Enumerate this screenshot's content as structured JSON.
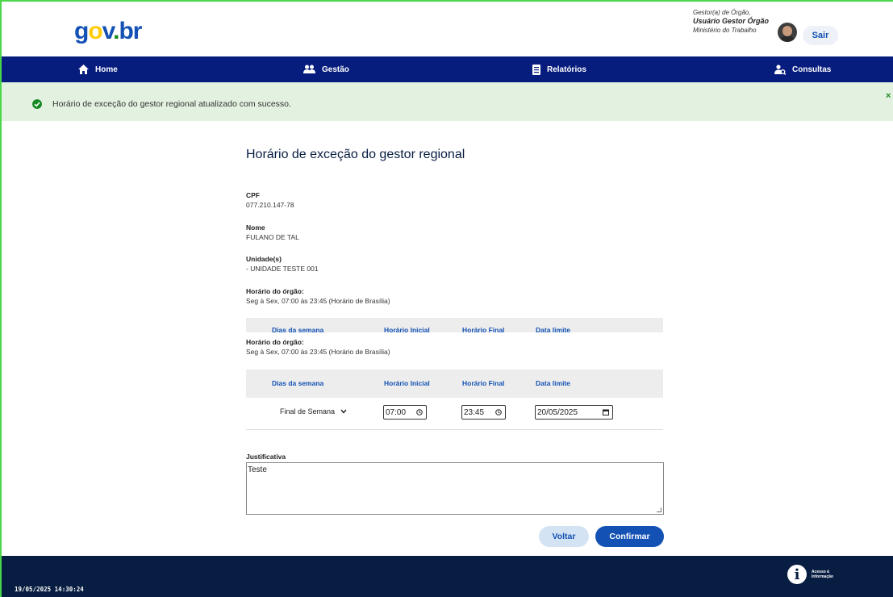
{
  "header": {
    "logo": {
      "g": "g",
      "o": "o",
      "v": "v",
      "dot": ".",
      "br": "br"
    },
    "user_role": "Gestor(a) de Órgão,",
    "user_name": "Usuário Gestor Órgão",
    "user_org": "Ministério do Trabalho",
    "logout_label": "Sair"
  },
  "nav": {
    "items": [
      {
        "label": "Home",
        "icon": "home-icon"
      },
      {
        "label": "Gestão",
        "icon": "users-icon"
      },
      {
        "label": "Relatórios",
        "icon": "document-icon"
      },
      {
        "label": "Consultas",
        "icon": "search-user-icon"
      }
    ]
  },
  "alert": {
    "message": "Horário de exceção do gestor regional atualizado com sucesso.",
    "close": "×"
  },
  "main": {
    "title": "Horário de exceção do gestor regional",
    "cpf_label": "CPF",
    "cpf": "077.210.147-78",
    "nome_label": "Nome",
    "nome": "FULANO DE TAL",
    "unidades_label": "Unidade(s)",
    "unidades": "- UNIDADE TESTE 001",
    "horario_label": "Horário do órgão:",
    "horario": "Seg à Sex, 07:00 às 23:45 (Horário de Brasília)",
    "horario_label_2": "Horário do órgão:",
    "horario_2": "Seg à Sex, 07:00 às 23:45 (Horário de Brasília)",
    "table": {
      "headers": [
        "Dias da semana",
        "Horário Inicial",
        "Horário Final",
        "Data limite"
      ],
      "row": {
        "dias": "Final de Semana",
        "inicio": "07:00",
        "fim": "23:45",
        "data_limite": "20/05/2025"
      }
    },
    "justificativa_label": "Justificativa",
    "justificativa": "Teste",
    "voltar_label": "Voltar",
    "confirmar_label": "Confirmar"
  },
  "footer": {
    "timestamp": "19/05/2025 14:30:24",
    "acesso_line1": "Acesso à",
    "acesso_line2": "Informação",
    "acesso_icon": "i"
  },
  "colors": {
    "nav_bg": "#071d7e",
    "primary": "#1351b4",
    "success_bg": "#e3f1e0",
    "success": "#168821",
    "footer_bg": "#071d41"
  }
}
